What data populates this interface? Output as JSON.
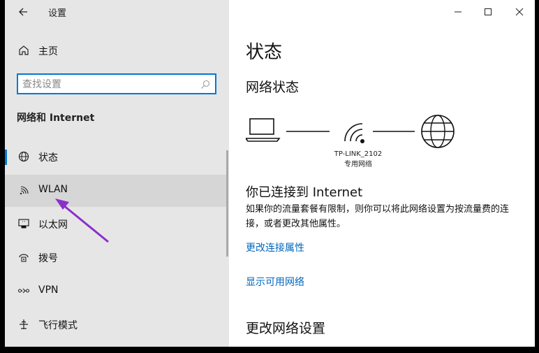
{
  "window": {
    "title": "设置",
    "back_icon": "back-arrow-icon",
    "controls": [
      "minimize-icon",
      "maximize-icon",
      "close-icon"
    ]
  },
  "sidebar": {
    "home_label": "主页",
    "search": {
      "placeholder": "查找设置",
      "icon": "search-icon"
    },
    "section_title": "网络和 Internet",
    "items": [
      {
        "label": "状态",
        "icon": "globe-icon",
        "selected": true
      },
      {
        "label": "WLAN",
        "icon": "wifi-icon",
        "hover": true
      },
      {
        "label": "以太网",
        "icon": "ethernet-icon"
      },
      {
        "label": "拨号",
        "icon": "dialup-icon"
      },
      {
        "label": "VPN",
        "icon": "vpn-icon"
      },
      {
        "label": "飞行模式",
        "icon": "airplane-icon"
      }
    ],
    "annotation_color": "#8b2fc9"
  },
  "main": {
    "title": "状态",
    "network_status_heading": "网络状态",
    "diagram": {
      "network_name": "TP-LINK_2102",
      "network_type": "专用网络"
    },
    "connected_heading": "你已连接到 Internet",
    "description": "如果你的流量套餐有限制，则你可以将此网络设置为按流量费的连接，或者更改其他属性。",
    "links": {
      "change_properties": "更改连接属性",
      "show_networks": "显示可用网络"
    },
    "change_settings_heading": "更改网络设置"
  },
  "colors": {
    "accent": "#0078d7",
    "link": "#0067c0",
    "sidebar_bg": "#e6e6e6"
  }
}
